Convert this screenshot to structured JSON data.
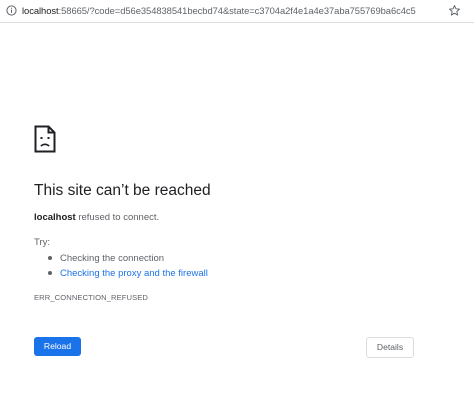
{
  "address_bar": {
    "url_host": "localhost",
    "url_rest": ":58665/?code=d56e354838541becbd74&state=c3704a2f4e1a4e37aba755769ba6c4c5",
    "info_icon": "info-circle-icon",
    "star_icon": "bookmark-star-icon"
  },
  "error": {
    "icon": "sad-page-icon",
    "title": "This site can’t be reached",
    "summary_host": "localhost",
    "summary_rest": " refused to connect.",
    "try_label": "Try:",
    "suggestions": [
      {
        "text": "Checking the connection",
        "is_link": false
      },
      {
        "text": "Checking the proxy and the firewall",
        "is_link": true
      }
    ],
    "code": "ERR_CONNECTION_REFUSED"
  },
  "buttons": {
    "reload": "Reload",
    "details": "Details"
  },
  "colors": {
    "accent": "#1a73e8",
    "text_primary": "#202124",
    "text_secondary": "#5f6368",
    "border": "#dadce0"
  }
}
